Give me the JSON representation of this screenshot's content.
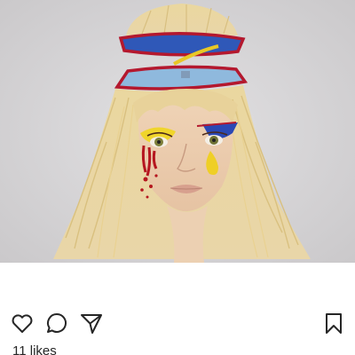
{
  "post": {
    "image": {
      "subject": "colored-pencil-drawing-of-blonde-woman-with-open-head"
    },
    "actions": {
      "like_icon": "heart-icon",
      "comment_icon": "comment-icon",
      "share_icon": "paper-plane-icon",
      "save_icon": "bookmark-icon"
    },
    "likes_text": "11 likes"
  },
  "colors": {
    "text": "#262626",
    "background": "#ffffff",
    "icon": "#262626"
  }
}
